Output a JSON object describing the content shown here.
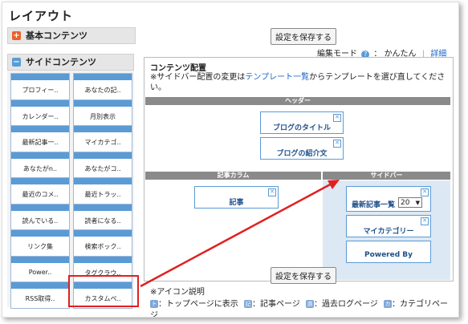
{
  "page": {
    "title": "レイアウト"
  },
  "left": {
    "basic_label": "基本コンテンツ",
    "side_label": "サイドコンテンツ",
    "tiles": [
      "プロフィー..",
      "あなたの記..",
      "カレンダー..",
      "月別表示",
      "最新記事一..",
      "マイカテゴ..",
      "あなたがn..",
      "あなたがコ..",
      "最近のコメ..",
      "最近トラッ..",
      "読んでいる..",
      "読者になる..",
      "リンク集",
      "検索ボック..",
      "Power..",
      "タグクラウ..",
      "RSS取得..",
      "カスタムペ.."
    ]
  },
  "toolbar": {
    "save_label": "設定を保存する",
    "edit_mode_label": "編集モード",
    "help_icon": "?",
    "mode_simple": "かんたん",
    "separator": "|",
    "mode_detail": "詳細"
  },
  "main": {
    "title": "コンテンツ配置",
    "note_prefix": "※サイドバー配置の変更は",
    "note_link": "テンプレート一覧",
    "note_suffix": "からテンプレートを選び直してください。",
    "header_strip": "ヘッダー",
    "header_blocks": [
      "ブログのタイトル",
      "ブログの紹介文"
    ],
    "article_strip": "記事カラム",
    "side_strip": "サイドバー",
    "article_block": "記事",
    "side_blocks": [
      "最新記事一覧",
      "マイカテゴリー",
      "Powered By"
    ],
    "count_value": "20",
    "x_glyph": "✕"
  },
  "legend": {
    "title": "※アイコン説明",
    "items": [
      {
        "icon": "ト",
        "text": "：トップページに表示"
      },
      {
        "icon": "記",
        "text": "：記事ページ"
      },
      {
        "icon": "過",
        "text": "：過去ログページ"
      },
      {
        "icon": "カ",
        "text": "：カテゴリペー"
      }
    ],
    "cut_text": "ジ"
  },
  "colors": {
    "accent_blue": "#5b9bd5",
    "highlight_red": "#e02020",
    "basic_icon": "#e8602c",
    "side_icon": "#5b9bd5"
  }
}
